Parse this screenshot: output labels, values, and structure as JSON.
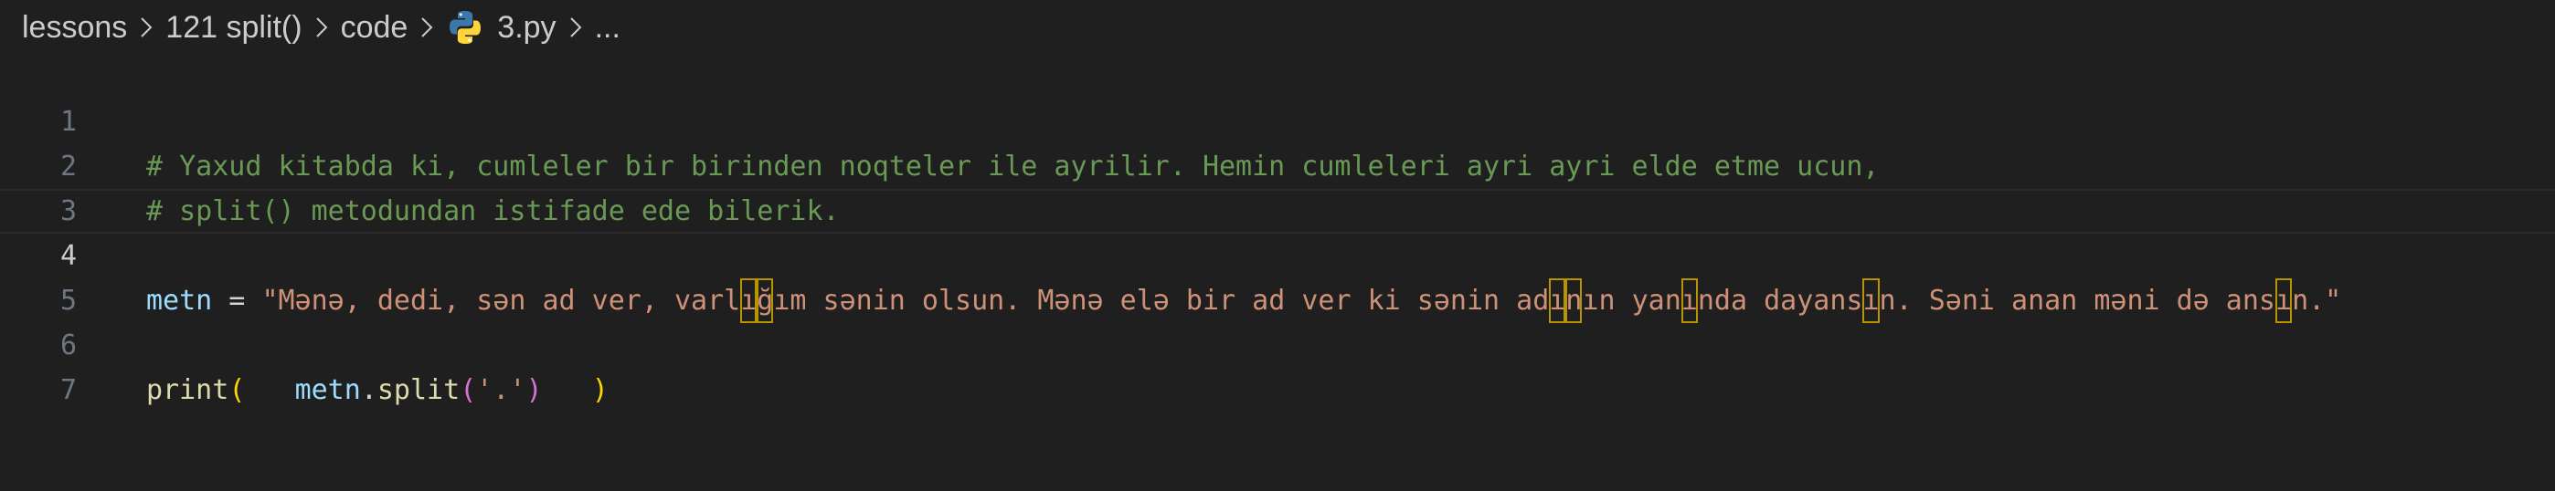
{
  "breadcrumb": {
    "items": [
      "lessons",
      "121 split()",
      "code",
      "3.py",
      "..."
    ],
    "file_icon": "python-icon"
  },
  "editor": {
    "line_numbers": [
      "1",
      "2",
      "3",
      "4",
      "5",
      "6",
      "7"
    ],
    "current_line": "4",
    "line1": "# Yaxud kitabda ki, cumleler bir birinden noqteler ile ayrilir. Hemin cumleleri ayri ayri elde etme ucun,",
    "line2": "# split() metodundan istifade ede bilerik.",
    "line4": {
      "var": "metn",
      "op": " = ",
      "string_parts": [
        "\"Mənə, dedi, sən ad ver, varl",
        "ı",
        "ğ",
        "ım sənin olsun. Mənə elə bir ad ver ki sənin ad",
        "ı",
        "n",
        "ın yan",
        "ı",
        "nda dayans",
        "ı",
        "n. Səni anan məni də ans",
        "ı",
        "n.\""
      ]
    },
    "line6": {
      "fn": "print",
      "open_paren": "(",
      "pad1": "   ",
      "obj": "metn",
      "dot": ".",
      "method": "split",
      "inner_open": "(",
      "arg": "'.'",
      "inner_close": ")",
      "pad2": "   ",
      "close_paren": ")"
    }
  },
  "colors": {
    "background": "#1f1f1f",
    "comment": "#6a9955",
    "string": "#ce9178",
    "variable": "#9cdcfe",
    "function": "#dcdcaa",
    "bracket_outer": "#ffd700",
    "bracket_inner": "#da70d6",
    "unicode_highlight": "#b89500"
  }
}
